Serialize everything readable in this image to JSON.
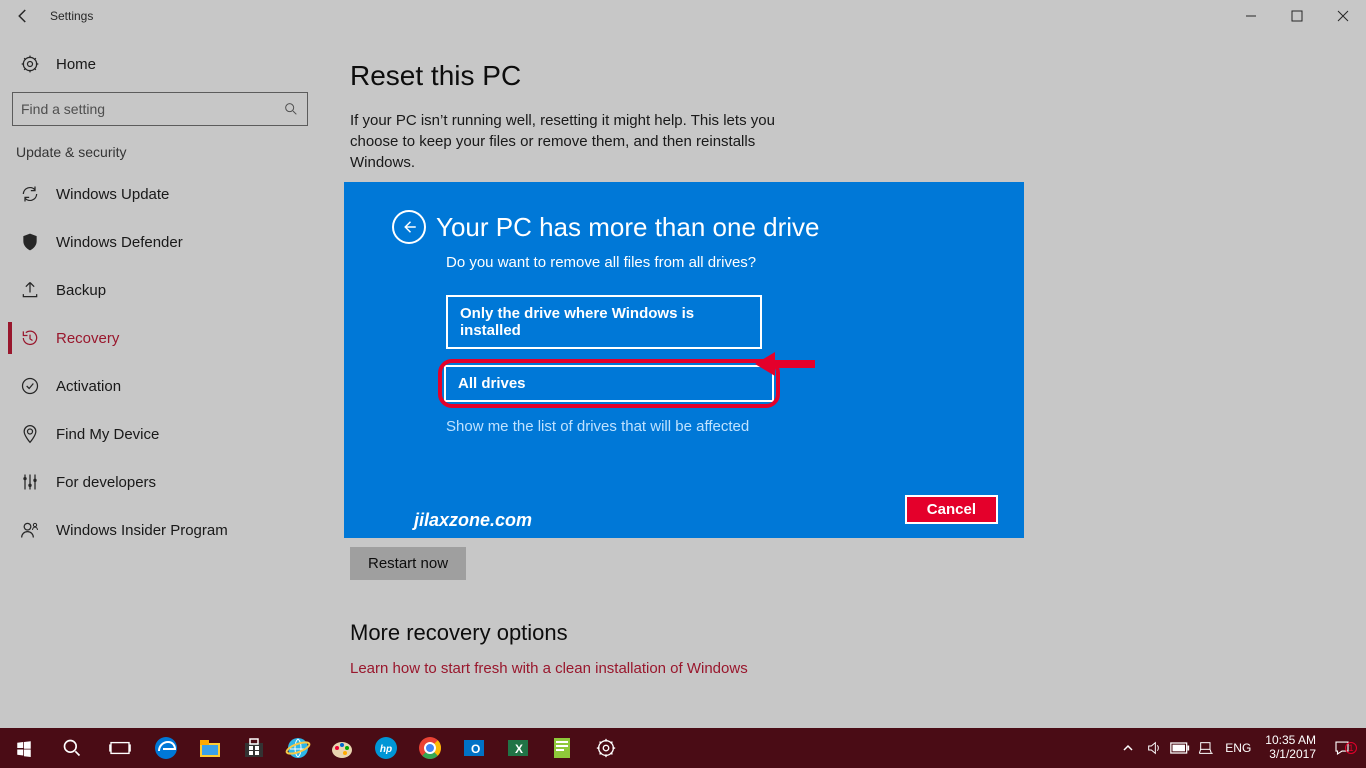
{
  "window": {
    "title": "Settings"
  },
  "sidebar": {
    "home": "Home",
    "search_placeholder": "Find a setting",
    "category": "Update & security",
    "items": [
      {
        "label": "Windows Update"
      },
      {
        "label": "Windows Defender"
      },
      {
        "label": "Backup"
      },
      {
        "label": "Recovery",
        "active": true
      },
      {
        "label": "Activation"
      },
      {
        "label": "Find My Device"
      },
      {
        "label": "For developers"
      },
      {
        "label": "Windows Insider Program"
      }
    ]
  },
  "main": {
    "reset_h": "Reset this PC",
    "reset_p": "If your PC isn’t running well, resetting it might help. This lets you choose to keep your files or remove them, and then reinstalls Windows.",
    "restart_btn": "Restart now",
    "more_h": "More recovery options",
    "more_link": "Learn how to start fresh with a clean installation of Windows"
  },
  "dialog": {
    "title": "Your PC has more than one drive",
    "subtitle": "Do you want to remove all files from all drives?",
    "opt1": "Only the drive where Windows is installed",
    "opt2": "All drives",
    "show_link": "Show me the list of drives that will be affected",
    "cancel": "Cancel"
  },
  "watermark": "jilaxzone.com",
  "taskbar": {
    "lang": "ENG",
    "time": "10:35 AM",
    "date": "3/1/2017",
    "notif_count": "1"
  }
}
